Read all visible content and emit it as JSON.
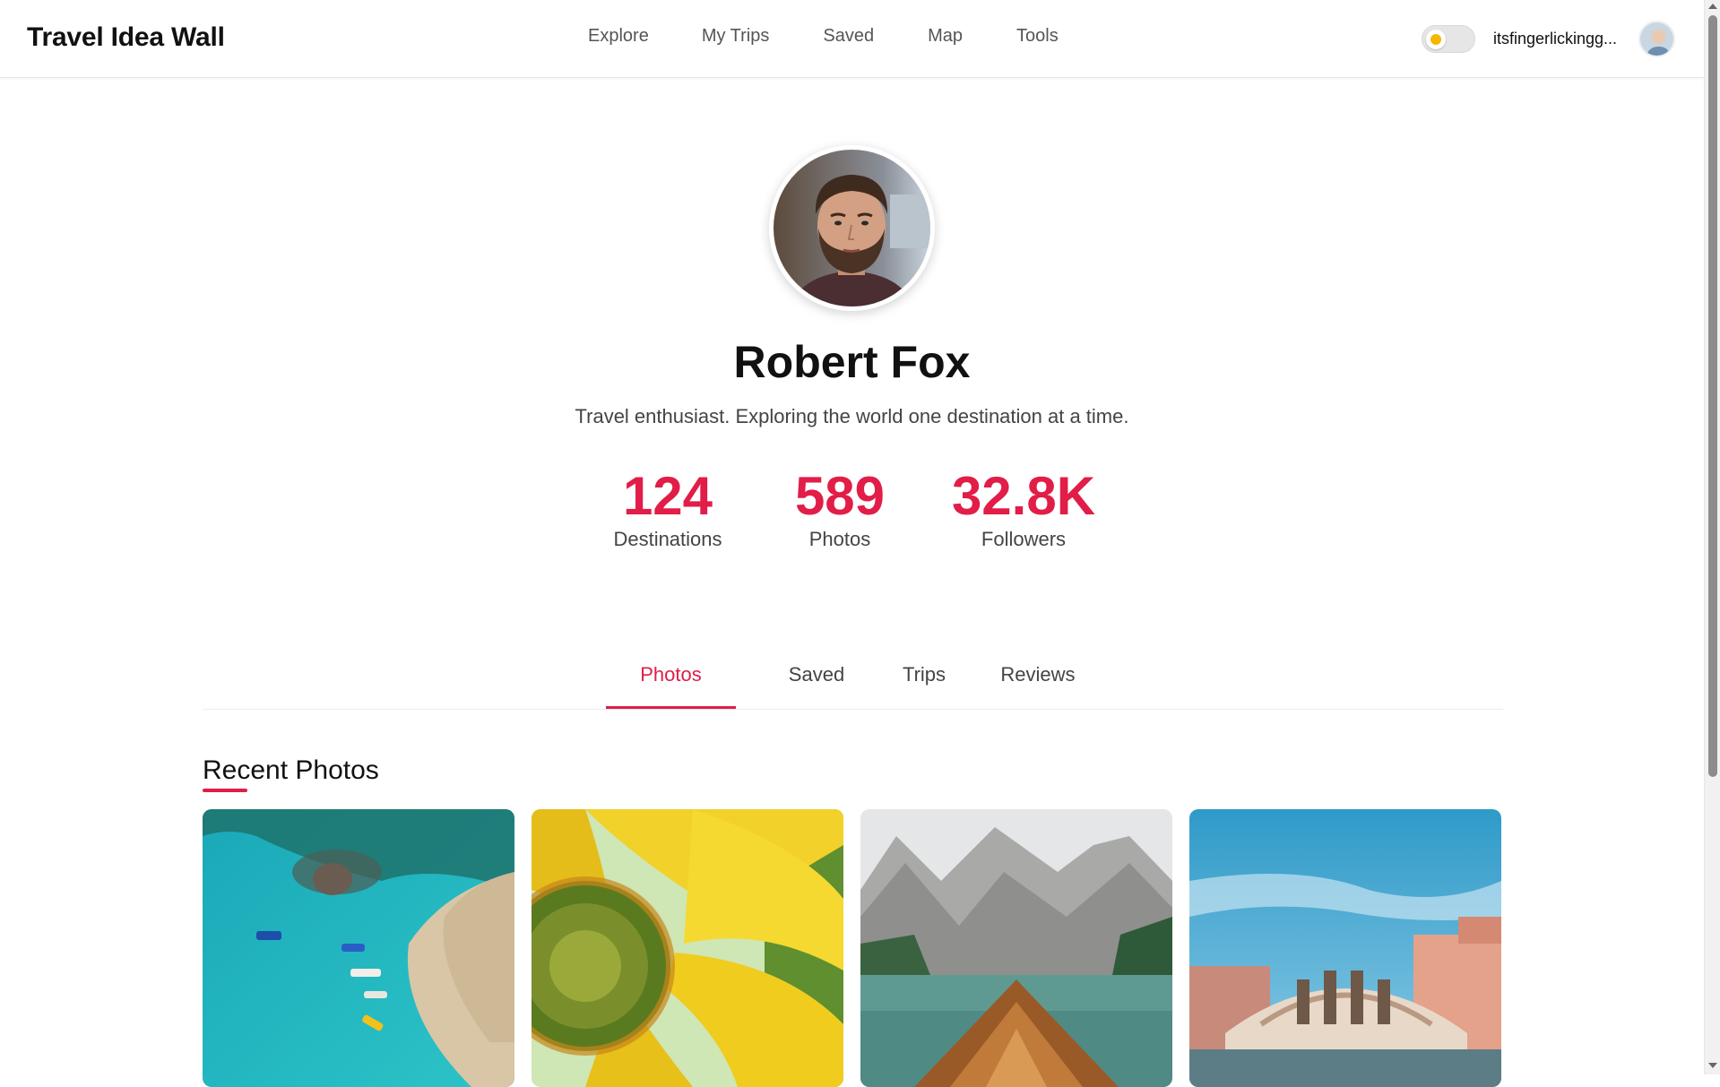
{
  "header": {
    "brand": "Travel Idea Wall",
    "nav": [
      "Explore",
      "My Trips",
      "Saved",
      "Map",
      "Tools"
    ],
    "username": "itsfingerlickingg...",
    "theme_icon": "sun-icon"
  },
  "profile": {
    "name": "Robert Fox",
    "bio": "Travel enthusiast. Exploring the world one destination at a time.",
    "stats": [
      {
        "value": "124",
        "label": "Destinations"
      },
      {
        "value": "589",
        "label": "Photos"
      },
      {
        "value": "32.8K",
        "label": "Followers"
      }
    ]
  },
  "tabs": {
    "items": [
      "Photos",
      "Saved",
      "Trips",
      "Reviews"
    ],
    "active": "Photos"
  },
  "recent": {
    "title": "Recent Photos"
  },
  "colors": {
    "accent": "#e11d48",
    "text": "#111111",
    "muted": "#444444"
  }
}
